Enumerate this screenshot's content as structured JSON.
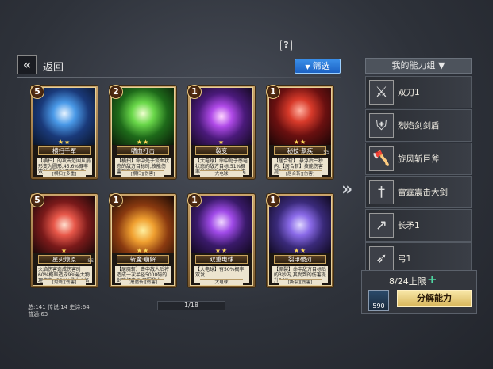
{
  "header": {
    "back_icon": "double-chevron-left-icon",
    "back_label": "返回",
    "help_icon": "question-icon",
    "filter_label": "筛选"
  },
  "cards": [
    {
      "count": "5",
      "stars": "★★",
      "name": "横扫千军",
      "desc": "【横扫】的攻击范围从扇形变为圆形,45.6%概率双发,30.4%概率三 发",
      "tag": "[横扫][多重]",
      "art": "slash-blue"
    },
    {
      "count": "2",
      "stars": "★★",
      "name": "嗜血打击",
      "desc": "【横扫】命中处于流血状态的敌方目标时,技能伤害提升72%",
      "tag": "[横扫][伤害]",
      "art": "slash-green"
    },
    {
      "count": "1",
      "stars": "★",
      "name": "裂变",
      "desc": "【大电球】命中处于感电状态的敌方目标,51%概率分裂出2个额外的小电球",
      "tag": "[大电球]",
      "art": "orb-purple"
    },
    {
      "count": "1",
      "stars": "★★",
      "name": "秘技·飙疾",
      "desc": "【居合斩】 悬浮后三秒内,【居合斩】技能伤害提升56%",
      "tag": "[居合斩][伤害]",
      "art": "silhouette-red",
      "ss": "SS"
    },
    {
      "count": "5",
      "stars": "★",
      "name": "星火燎原",
      "desc": "火焰伤害造成伤害时60%概率造成9%最大物理伤害+380%最大火焰伤害",
      "tag": "[灼烧][伤害]",
      "art": "fire-red",
      "ss": "SS"
    },
    {
      "count": "1",
      "stars": "★★",
      "name": "斩魔·崩解",
      "desc": "【屠魔斩】击中敌人后将造成一次半径5000码的剑鸣打击,对周围敌人",
      "tag": "[屠魔斩][伤害]",
      "art": "fighter-orange"
    },
    {
      "count": "1",
      "stars": "★★",
      "name": "双重电球",
      "desc": "【大电球】有50%概率双发",
      "tag": "[大电球]",
      "art": "lightning-purple"
    },
    {
      "count": "1",
      "stars": "★★",
      "name": "裂甲破刃",
      "desc": "【撕裂】命中敌方目标后的3秒内,其受到的伤害提升56%",
      "tag": "[撕裂][伤害]",
      "art": "blade-purple"
    }
  ],
  "ability_group": {
    "header": "我的能力组",
    "items": [
      {
        "name": "双刀1",
        "icon": "crossed-swords-icon"
      },
      {
        "name": "烈焰剑剑盾",
        "icon": "sword-shield-icon"
      },
      {
        "name": "旋风斩巨斧",
        "icon": "axe-icon"
      },
      {
        "name": "雷霆震击大剑",
        "icon": "greatsword-icon"
      },
      {
        "name": "长矛1",
        "icon": "spear-icon"
      },
      {
        "name": "弓1",
        "icon": "bow-icon"
      }
    ]
  },
  "capacity": {
    "text": "8/24上限",
    "resource_count": "590",
    "decompose_label": "分解能力"
  },
  "stats": {
    "line1": "总:141 传说:14 史诗:64",
    "line2": "普通:63"
  },
  "pager": {
    "text": "1/18"
  },
  "colors": {
    "filter": "#2a7ad8",
    "decompose": "#e8cc7a",
    "plus": "#4fd6a2"
  }
}
